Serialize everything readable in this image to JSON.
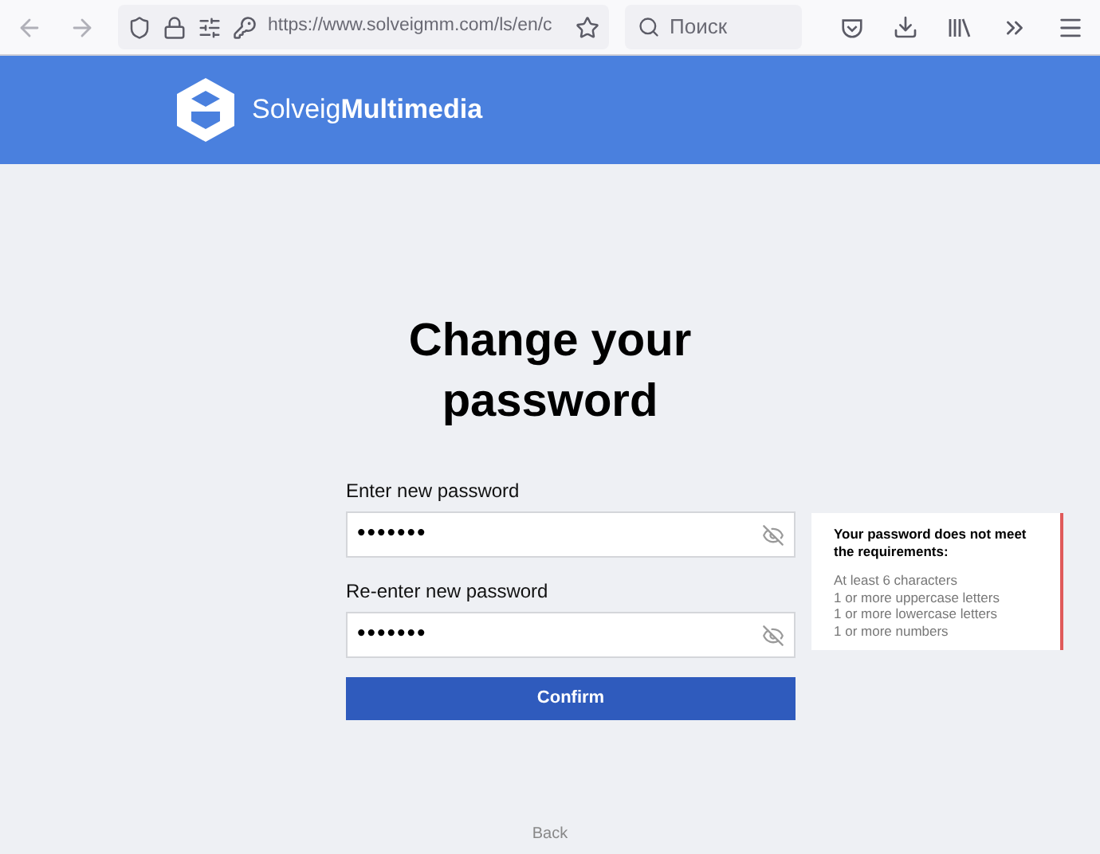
{
  "browser": {
    "url": "https://www.solveigmm.com/ls/en/c",
    "search": {
      "placeholder": "Поиск"
    }
  },
  "header": {
    "logo_text": "Solveig**Multimedia**"
  },
  "title": "Change your password",
  "fields": [
    {
      "label": "Enter new password",
      "value": "•••••••"
    },
    {
      "label": "Re-enter new password",
      "value": "•••••••"
    }
  ],
  "confirm_button": "Confirm",
  "requirements": {
    "heading": "Your password does not meet the requirements:",
    "items": [
      "At least 6 characters",
      "1 or more uppercase letters",
      "1 or more lowercase letters",
      "1 or more numbers"
    ]
  },
  "back_link": "Back"
}
